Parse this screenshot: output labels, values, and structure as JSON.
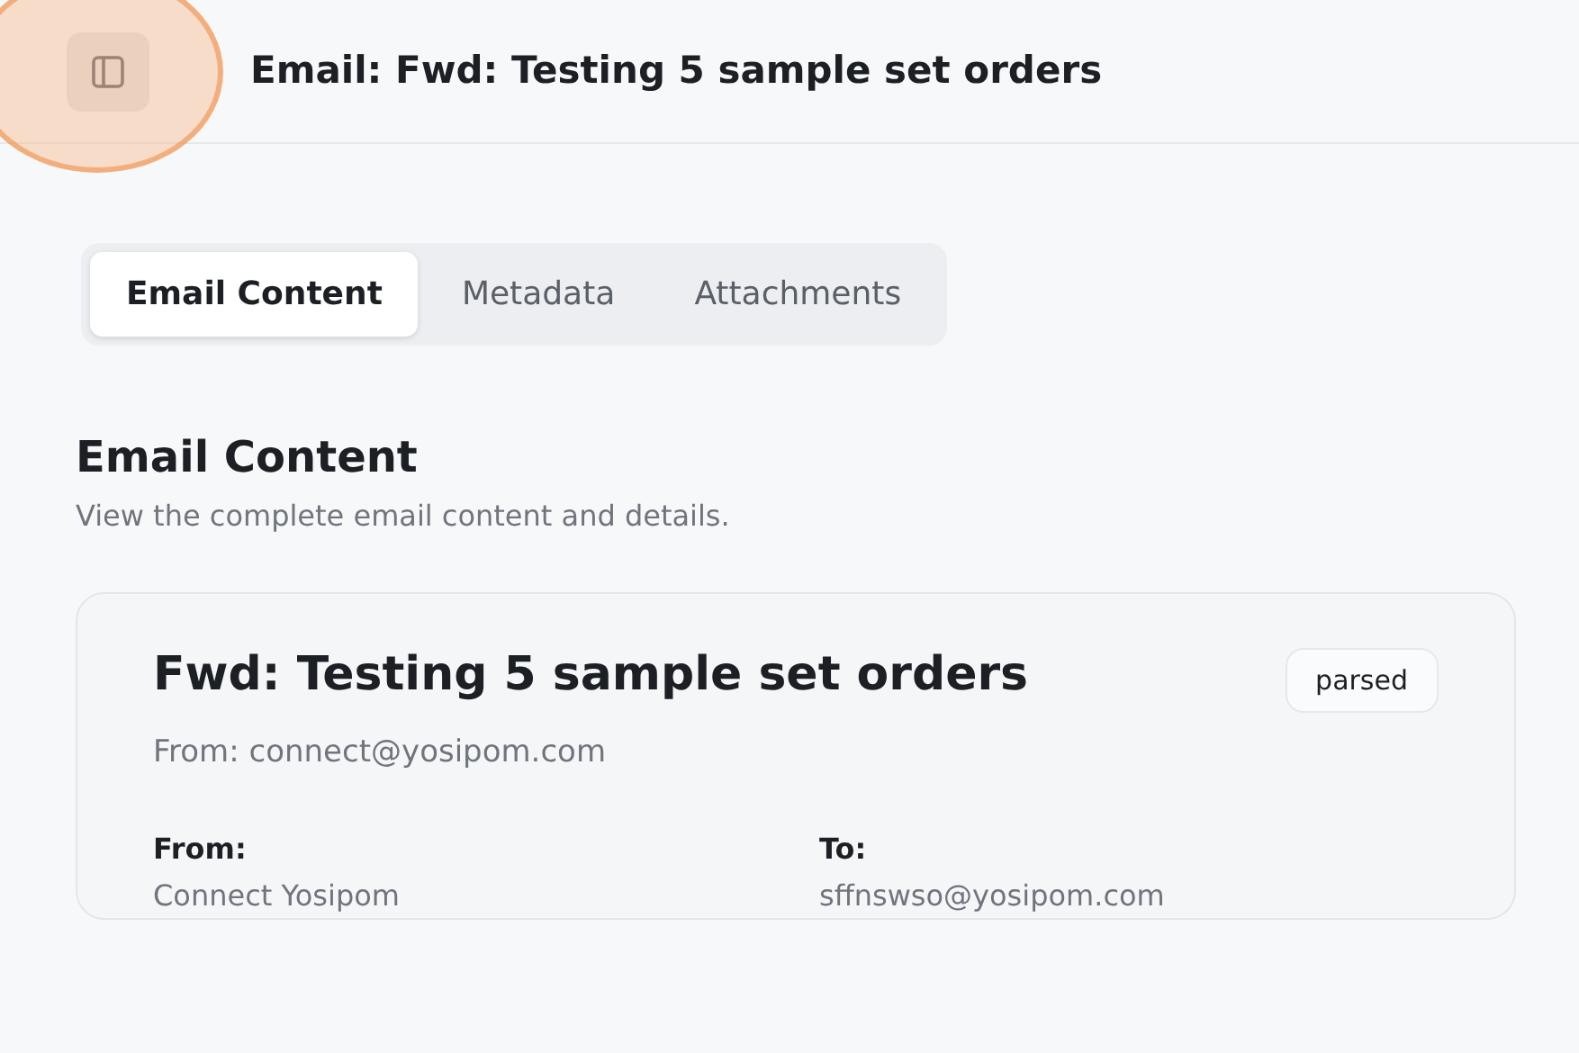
{
  "header": {
    "title": "Email: Fwd: Testing 5 sample set orders"
  },
  "tabs": [
    {
      "label": "Email Content",
      "selected": true
    },
    {
      "label": "Metadata",
      "selected": false
    },
    {
      "label": "Attachments",
      "selected": false
    }
  ],
  "section": {
    "title": "Email Content",
    "subtitle": "View the complete email content and details."
  },
  "email": {
    "subject": "Fwd: Testing 5 sample set orders",
    "status": "parsed",
    "from_line": "From: connect@yosipom.com",
    "fields": [
      {
        "label": "From:",
        "value": "Connect Yosipom"
      },
      {
        "label": "To:",
        "value": "sffnswso@yosipom.com"
      }
    ]
  }
}
